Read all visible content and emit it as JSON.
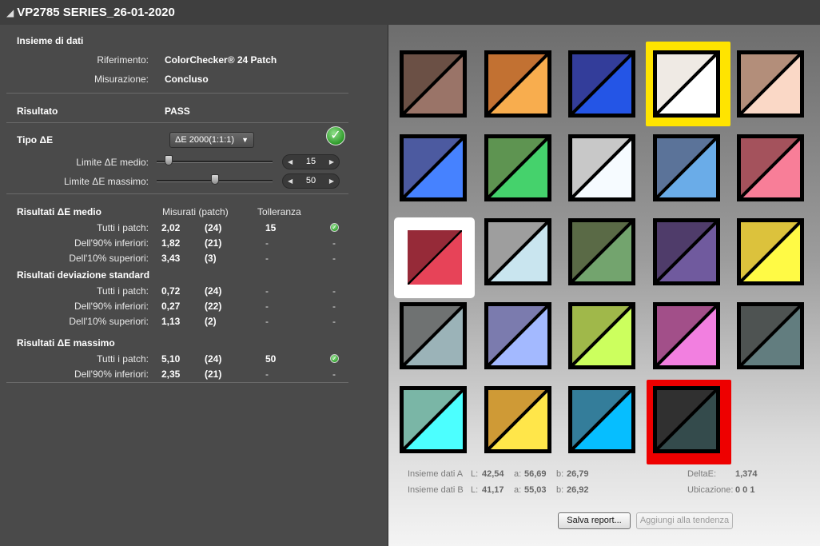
{
  "window": {
    "title": "VP2785 SERIES_26-01-2020"
  },
  "dataset": {
    "heading": "Insieme di dati",
    "reference_label": "Riferimento:",
    "reference_value": "ColorChecker® 24 Patch",
    "measurement_label": "Misurazione:",
    "measurement_value": "Concluso"
  },
  "result": {
    "label": "Risultato",
    "value": "PASS"
  },
  "delta_type": {
    "label": "Tipo ΔE",
    "selected": "ΔE 2000(1:1:1)",
    "avg_limit_label": "Limite ΔE medio:",
    "avg_limit_value": "15",
    "avg_limit_level": 0.1,
    "max_limit_label": "Limite ΔE massimo:",
    "max_limit_value": "50",
    "max_limit_level": 0.5
  },
  "avg_results": {
    "heading": "Risultati ΔE medio",
    "col_measured": "Misurati (patch)",
    "col_tolerance": "Tolleranza",
    "rows": [
      {
        "label": "Tutti i patch:",
        "value": "2,02",
        "count": "(24)",
        "tolerance": "15",
        "status": "pass"
      },
      {
        "label": "Dell'90% inferiori:",
        "value": "1,82",
        "count": "(21)",
        "tolerance": "-",
        "status": "-"
      },
      {
        "label": "Dell'10% superiori:",
        "value": "3,43",
        "count": "(3)",
        "tolerance": "-",
        "status": "-"
      }
    ]
  },
  "std_results": {
    "heading": "Risultati deviazione standard",
    "rows": [
      {
        "label": "Tutti i patch:",
        "value": "0,72",
        "count": "(24)",
        "tolerance": "-",
        "status": "-"
      },
      {
        "label": "Dell'90% inferiori:",
        "value": "0,27",
        "count": "(22)",
        "tolerance": "-",
        "status": "-"
      },
      {
        "label": "Dell'10% superiori:",
        "value": "1,13",
        "count": "(2)",
        "tolerance": "-",
        "status": "-"
      }
    ]
  },
  "max_results": {
    "heading": "Risultati ΔE massimo",
    "rows": [
      {
        "label": "Tutti i patch:",
        "value": "5,10",
        "count": "(24)",
        "tolerance": "50",
        "status": "pass"
      },
      {
        "label": "Dell'90% inferiori:",
        "value": "2,35",
        "count": "(21)",
        "tolerance": "-",
        "status": "-"
      }
    ]
  },
  "patches": [
    {
      "ref": "#6b5045",
      "meas": "#9a7468"
    },
    {
      "ref": "#c27132",
      "meas": "#f8ad4e"
    },
    {
      "ref": "#333d9a",
      "meas": "#2455e6"
    },
    {
      "ref": "#efeae4",
      "meas": "#ffffff"
    },
    {
      "ref": "#b38e7a",
      "meas": "#fad8c6"
    },
    {
      "ref": "#4c5aa0",
      "meas": "#4682ff"
    },
    {
      "ref": "#5e9451",
      "meas": "#45d26c"
    },
    {
      "ref": "#c8c8c8",
      "meas": "#f6fbff"
    },
    {
      "ref": "#5b7399",
      "meas": "#6aace8"
    },
    {
      "ref": "#a4525c",
      "meas": "#f87e98"
    },
    {
      "ref": "#962a38",
      "meas": "#e74358"
    },
    {
      "ref": "#9e9e9e",
      "meas": "#c9e5ef"
    },
    {
      "ref": "#5a6a46",
      "meas": "#73a46e"
    },
    {
      "ref": "#4f3c6a",
      "meas": "#705a9e"
    },
    {
      "ref": "#dcc23c",
      "meas": "#fffa45"
    },
    {
      "ref": "#6f7272",
      "meas": "#9bb3b8"
    },
    {
      "ref": "#7b7bae",
      "meas": "#a3b9ff"
    },
    {
      "ref": "#a0b84a",
      "meas": "#ccff5e"
    },
    {
      "ref": "#a24f89",
      "meas": "#f27fe0"
    },
    {
      "ref": "#4e5352",
      "meas": "#627d7f"
    },
    {
      "ref": "#7ab6a6",
      "meas": "#4cffff"
    },
    {
      "ref": "#cf9a36",
      "meas": "#ffe64a"
    },
    {
      "ref": "#347d9a",
      "meas": "#06beff"
    },
    {
      "ref": "#303030",
      "meas": "#344b4c"
    }
  ],
  "highlights": {
    "yellow_index": 3,
    "white_index": 10,
    "red_index": 23,
    "yellow": "#ffe400",
    "white": "#ffffff",
    "red": "#ee0000"
  },
  "details": {
    "a_label": "Insieme dati A",
    "a_L_label": "L:",
    "a_L": "42,54",
    "a_a_label": "a:",
    "a_a": "56,69",
    "a_b_label": "b:",
    "a_b": "26,79",
    "b_label": "Insieme dati B",
    "b_L_label": "L:",
    "b_L": "41,17",
    "b_a_label": "a:",
    "b_a": "55,03",
    "b_b_label": "b:",
    "b_b": "26,92",
    "delta_label": "DeltaE:",
    "delta_value": "1,374",
    "location_label": "Ubicazione:",
    "location_value": "0 0 1"
  },
  "buttons": {
    "save_report": "Salva report...",
    "add_trend": "Aggiungi alla tendenza"
  },
  "icons": {
    "title_icon": "eraser-icon",
    "pass_icon": "check-circle-icon"
  }
}
